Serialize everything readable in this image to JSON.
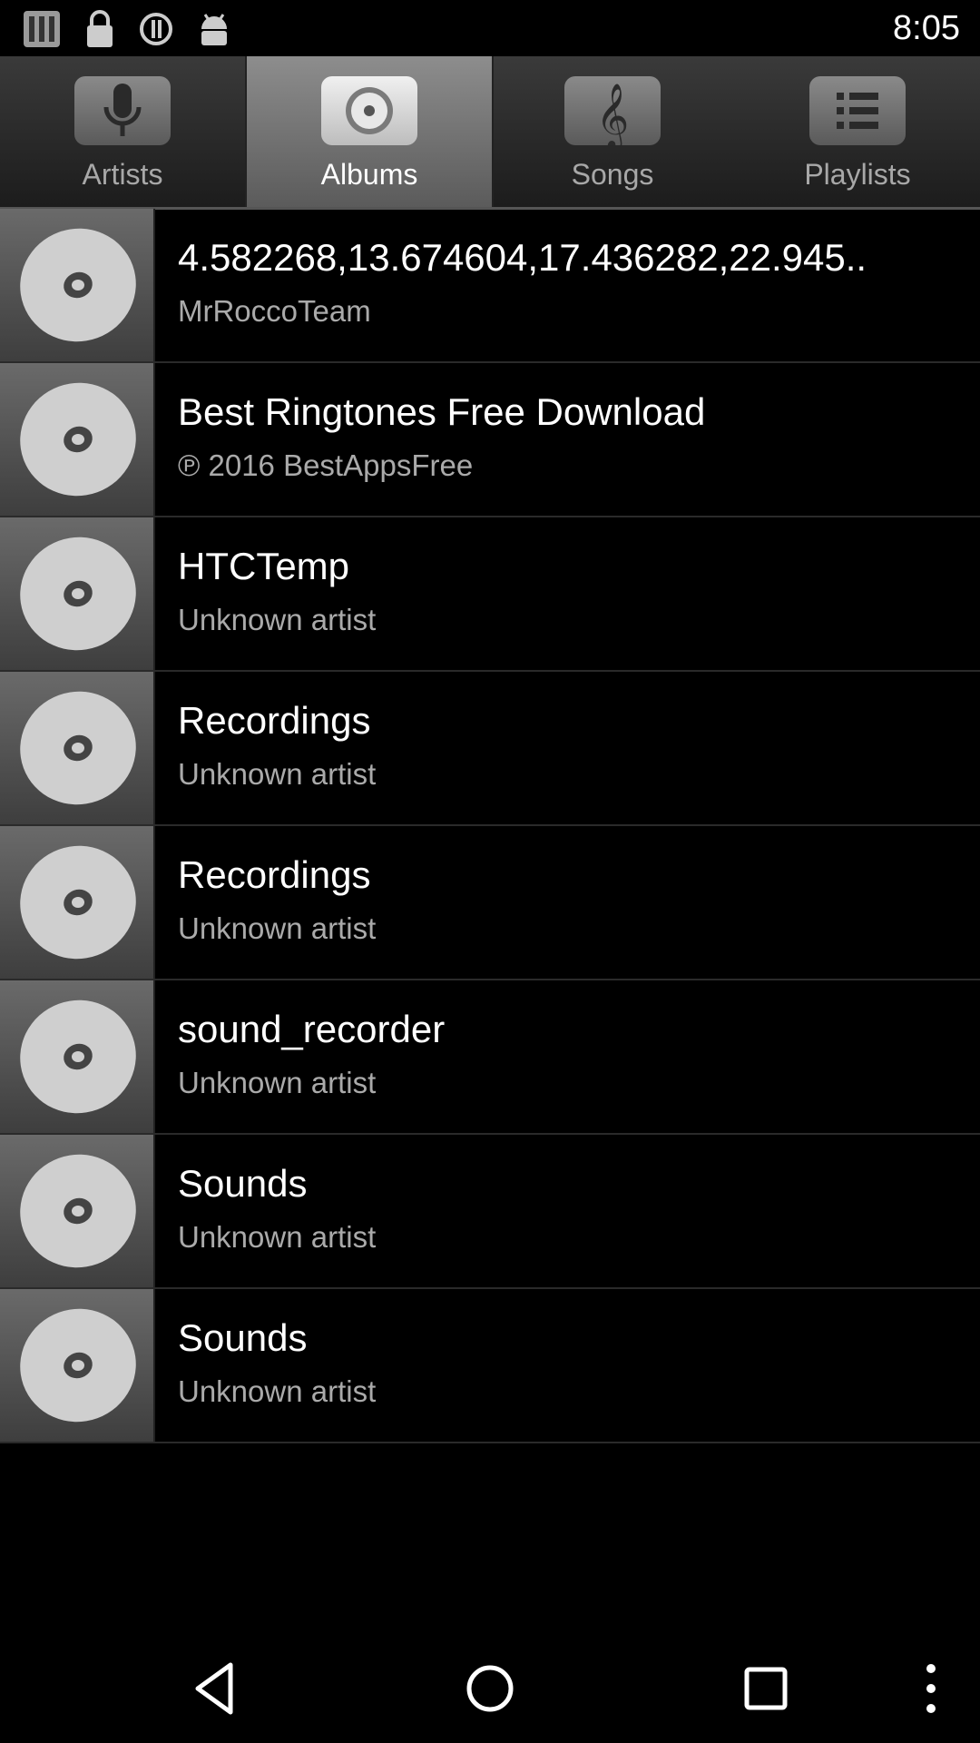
{
  "status_bar": {
    "time": "8:05",
    "icons": [
      "sim-icon",
      "lock-icon",
      "alert-icon",
      "android-icon"
    ]
  },
  "tabs": [
    {
      "label": "Artists",
      "icon": "microphone-icon",
      "active": false
    },
    {
      "label": "Albums",
      "icon": "disc-icon",
      "active": true
    },
    {
      "label": "Songs",
      "icon": "treble-clef-icon",
      "active": false
    },
    {
      "label": "Playlists",
      "icon": "list-icon",
      "active": false
    }
  ],
  "albums": [
    {
      "title": "4.582268,13.674604,17.436282,22.945..",
      "artist": "MrRoccoTeam"
    },
    {
      "title": "Best Ringtones Free Download",
      "artist": "℗ 2016 BestAppsFree"
    },
    {
      "title": "HTCTemp",
      "artist": "Unknown artist"
    },
    {
      "title": "Recordings",
      "artist": "Unknown artist"
    },
    {
      "title": "Recordings",
      "artist": "Unknown artist"
    },
    {
      "title": "sound_recorder",
      "artist": "Unknown artist"
    },
    {
      "title": "Sounds",
      "artist": "Unknown artist"
    },
    {
      "title": "Sounds",
      "artist": "Unknown artist"
    }
  ],
  "nav": {
    "buttons": [
      "back-icon",
      "home-icon",
      "recents-icon",
      "overflow-menu-icon"
    ]
  }
}
